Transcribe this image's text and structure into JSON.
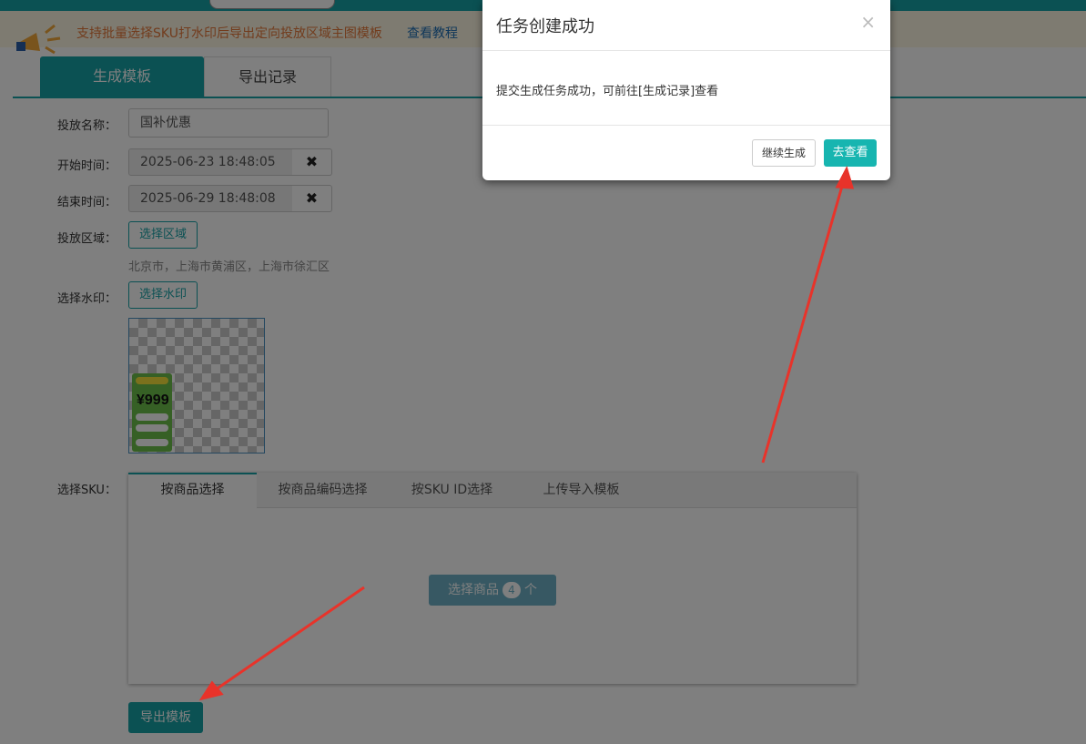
{
  "notice": {
    "text": "支持批量选择SKU打水印后导出定向投放区域主图模板",
    "link": "查看教程"
  },
  "tabs": {
    "generate": "生成模板",
    "export_records": "导出记录"
  },
  "form": {
    "name_label": "投放名称：",
    "name_value": "国补优惠",
    "start_label": "开始时间：",
    "start_value": "2025-06-23 18:48:05",
    "end_label": "结束时间：",
    "end_value": "2025-06-29 18:48:08",
    "region_label": "投放区域：",
    "region_button": "选择区域",
    "region_text": "北京市，上海市黄浦区，上海市徐汇区",
    "watermark_label": "选择水印：",
    "watermark_button": "选择水印",
    "watermark_price": "¥999",
    "sku_label": "选择SKU："
  },
  "sku": {
    "tabs": [
      "按商品选择",
      "按商品编码选择",
      "按SKU ID选择",
      "上传导入模板"
    ],
    "select_goods_label": "选择商品",
    "select_goods_count": "4",
    "select_goods_unit": "个"
  },
  "export_button": "导出模板",
  "modal": {
    "title": "任务创建成功",
    "close": "×",
    "body": "提交生成任务成功，可前往[生成记录]查看",
    "continue_button": "继续生成",
    "view_button": "去查看"
  },
  "colors": {
    "primary": "#17a2a7",
    "notice_text": "#e4783a",
    "arrow": "#e8332a"
  }
}
